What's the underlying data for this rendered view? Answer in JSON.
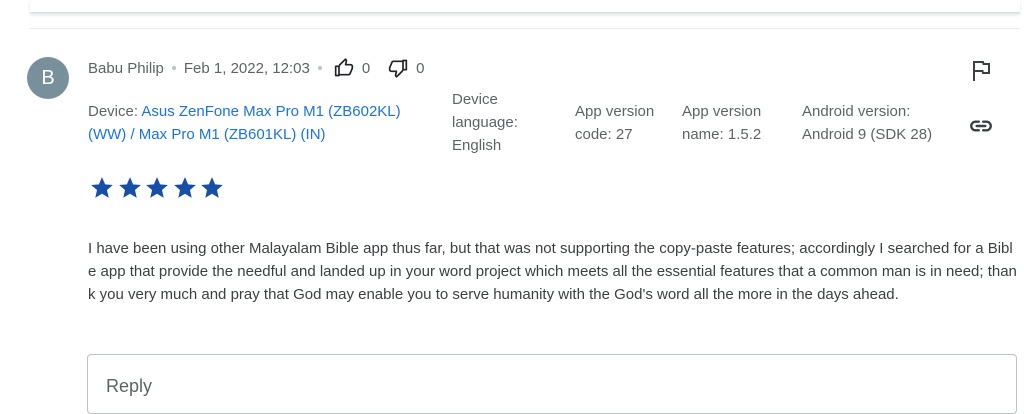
{
  "review": {
    "avatar_letter": "B",
    "author": "Babu Philip",
    "date": "Feb 1, 2022, 12:03",
    "thumbs_up_count": "0",
    "thumbs_down_count": "0",
    "device_label": "Device: ",
    "device_name": "Asus ZenFone Max Pro M1 (ZB602KL) (WW) / Max Pro M1 (ZB601KL) (IN)",
    "device_language": "Device language: English",
    "app_version_code": "App version code: 27",
    "app_version_name": "App version name: 1.5.2",
    "android_version": "Android version: Android 9 (SDK 28)",
    "rating": 5,
    "text": "I have been using other Malayalam Bible app thus far, but that was not supporting the copy-paste features; accordingly I searched for a Bible app that provide the needful and landed up in your word project which meets all the essential features that a common man is in need; thank you very much and pray that God may enable you to serve humanity with the God's word all the more in the days ahead."
  },
  "reply": {
    "placeholder": "Reply"
  },
  "icons": {
    "flag": "flag-icon",
    "link": "link-icon",
    "thumb_up": "thumb-up-icon",
    "thumb_down": "thumb-down-icon",
    "star": "star-icon"
  },
  "colors": {
    "avatar_bg": "#78909c",
    "star": "#174ea6",
    "link": "#1a73e8"
  }
}
